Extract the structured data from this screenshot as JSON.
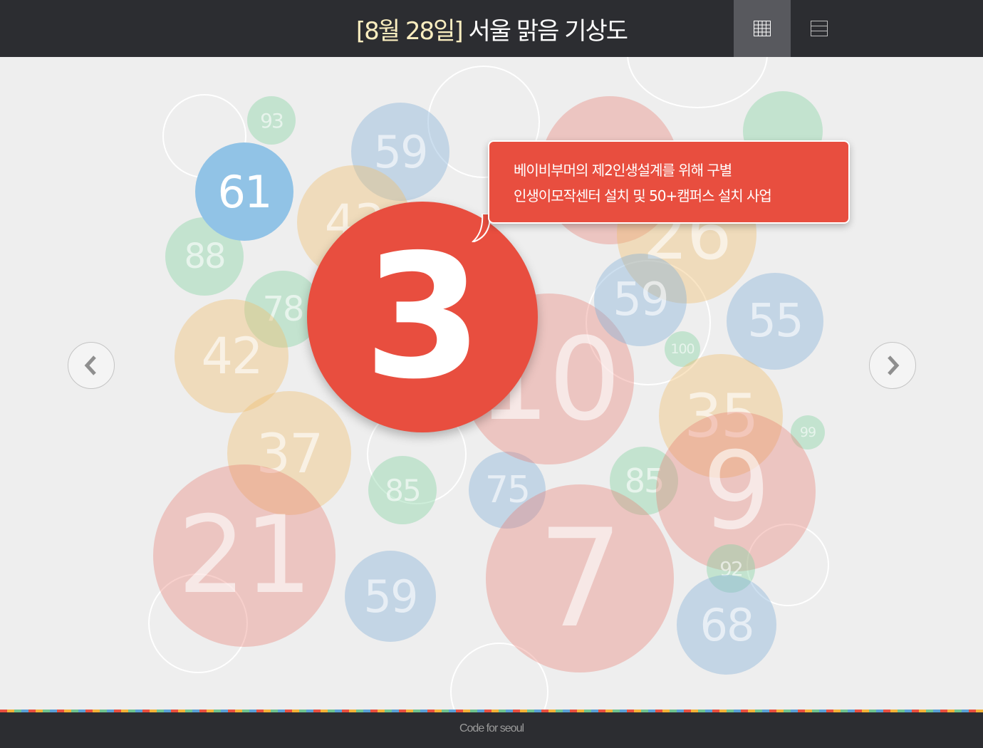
{
  "header": {
    "title_date": "[8월 28일]",
    "title_text": " 서울 맑음 기상도",
    "grid_view_icon": "grid-icon",
    "list_view_icon": "list-icon"
  },
  "main_number": "3",
  "callout": {
    "line1": "베이비부머의 제2인생설계를 위해 구별",
    "line2": "인생이모작센터 설치 및 50+캠퍼스 설치 사업"
  },
  "navigation": {
    "prev_icon": "chevron-left-icon",
    "next_icon": "chevron-right-icon"
  },
  "bubbles": [
    "93",
    "59",
    "61",
    "88",
    "43",
    "88",
    "78",
    "42",
    "37",
    "21",
    "85",
    "75",
    "59",
    "10",
    "59",
    "26",
    "55",
    "100",
    "35",
    "99",
    "85",
    "9",
    "92",
    "7",
    "68"
  ],
  "footer": {
    "text": "Code for seoul"
  },
  "colors": {
    "header_bg": "#2c2d31",
    "accent_red": "#e84e3f",
    "date_color": "#fbeec0"
  }
}
